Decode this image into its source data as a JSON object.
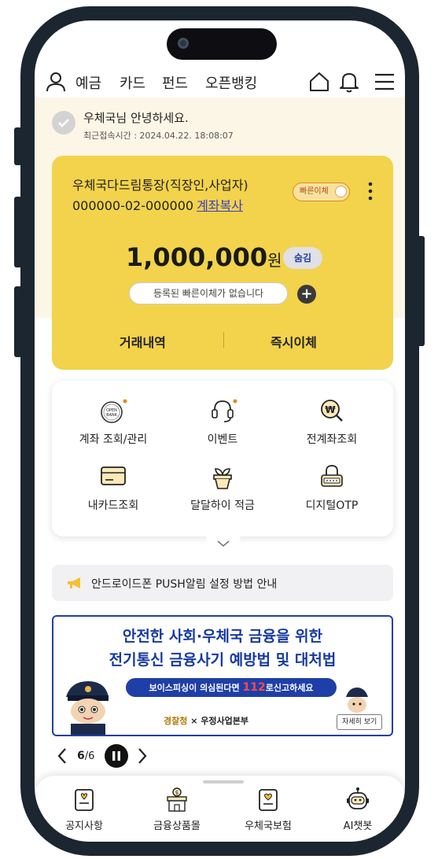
{
  "nav": {
    "items": [
      "예금",
      "카드",
      "펀드",
      "오픈뱅킹"
    ]
  },
  "greeting": {
    "name": "우체국님 안녕하세요.",
    "last_login": "최근접속시간 : 2024.04.22. 18:08:07"
  },
  "account": {
    "name": "우체국다드림통장(직장인,사업자)",
    "number": "000000-02-000000",
    "copy_label": "계좌복사",
    "quick_transfer_label": "빠른이체",
    "balance": "1,000,000",
    "unit": "원",
    "hide_label": "숨김",
    "no_quick_transfer": "등록된 빠른이체가 없습니다",
    "add_symbol": "+",
    "actions": [
      "거래내역",
      "즉시이체"
    ]
  },
  "menu": {
    "items": [
      {
        "label": "계좌 조회/관리",
        "icon": "open-bank-icon",
        "badge": true
      },
      {
        "label": "이벤트",
        "icon": "headset-icon",
        "badge": true
      },
      {
        "label": "전계좌조회",
        "icon": "won-search-icon",
        "badge": false
      },
      {
        "label": "내카드조회",
        "icon": "card-icon",
        "badge": false
      },
      {
        "label": "달달하이 적금",
        "icon": "plant-pot-icon",
        "badge": false
      },
      {
        "label": "디지털OTP",
        "icon": "otp-lock-icon",
        "badge": false
      }
    ],
    "open_bank_badge": "OPEN BANK"
  },
  "notice": {
    "text": "안드로이드폰 PUSH알림 설정 방법 안내"
  },
  "banner": {
    "line1": "안전한 사회·우체국 금융을 위한",
    "line2": "전기통신 금융사기 예방법 및 대처법",
    "pill_pre": "보이스피싱이 의심된다면 ",
    "pill_number": "112",
    "pill_post": "로신고하세요",
    "org1": "경찰청",
    "times": " × ",
    "org2": "우정사업본부",
    "more": "자세히 보기"
  },
  "pager": {
    "current": "6",
    "total": "/6"
  },
  "tabs": [
    {
      "label": "공지사항",
      "icon": "notice-icon"
    },
    {
      "label": "금융상품몰",
      "icon": "shop-icon"
    },
    {
      "label": "우체국보험",
      "icon": "insurance-icon"
    },
    {
      "label": "AI챗봇",
      "icon": "robot-icon"
    }
  ],
  "colors": {
    "card": "#f2d34b",
    "greeting_bg": "#fcf6e6",
    "brand_blue": "#1f3fa8",
    "badge_orange": "#e08a1e"
  }
}
